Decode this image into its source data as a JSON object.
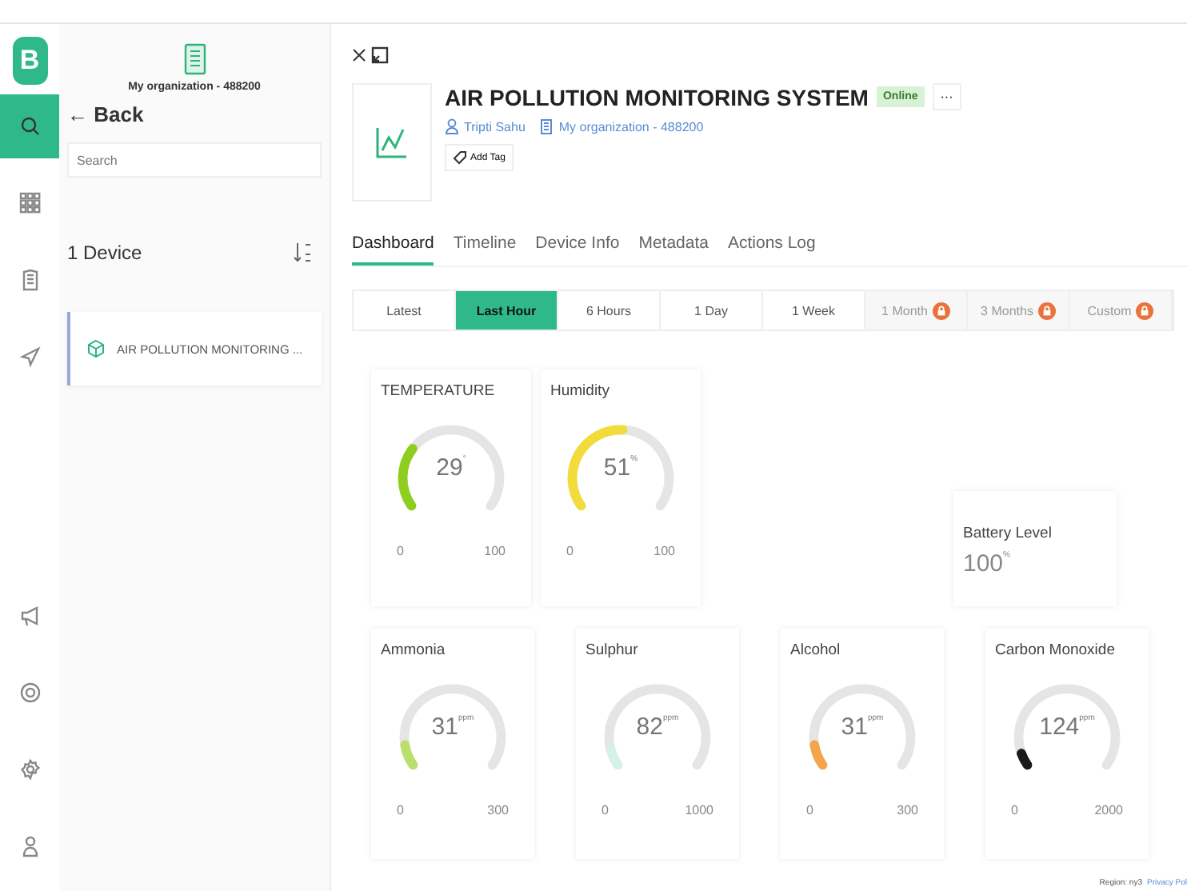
{
  "rail": {
    "logo": "B",
    "top_items": [
      {
        "kind": "search",
        "selected": true
      },
      {
        "kind": "grid",
        "selected": false
      },
      {
        "kind": "building",
        "selected": false
      },
      {
        "kind": "send",
        "selected": false
      }
    ],
    "bottom_items": [
      {
        "kind": "megaphone"
      },
      {
        "kind": "lifebuoy"
      },
      {
        "kind": "gear"
      },
      {
        "kind": "person"
      }
    ]
  },
  "sidebar": {
    "organization": "My organization - 488200",
    "back": "← Back",
    "search": {
      "placeholder": "Search"
    },
    "device_count": "1 Device",
    "devices": [
      {
        "name": "AIR POLLUTION MONITORING ...",
        "selected": true
      }
    ]
  },
  "device": {
    "title": "AIR POLLUTION MONITORING SYSTEM",
    "status": "Online",
    "owner": "Tripti Sahu",
    "organization": "My organization - 488200",
    "add_tag": "Add Tag",
    "more": "···"
  },
  "tabs": [
    {
      "label": "Dashboard",
      "selected": true
    },
    {
      "label": "Timeline",
      "selected": false
    },
    {
      "label": "Device Info",
      "selected": false
    },
    {
      "label": "Metadata",
      "selected": false
    },
    {
      "label": "Actions Log",
      "selected": false
    }
  ],
  "time_ranges": [
    {
      "label": "Latest",
      "selected": false,
      "locked": false
    },
    {
      "label": "Last Hour",
      "selected": true,
      "locked": false
    },
    {
      "label": "6 Hours",
      "selected": false,
      "locked": false
    },
    {
      "label": "1 Day",
      "selected": false,
      "locked": false
    },
    {
      "label": "1 Week",
      "selected": false,
      "locked": false
    },
    {
      "label": "1 Month",
      "selected": false,
      "locked": true
    },
    {
      "label": "3 Months",
      "selected": false,
      "locked": true
    },
    {
      "label": "Custom",
      "selected": false,
      "locked": true
    }
  ],
  "widget_rows": [
    [
      {
        "kind": "gauge",
        "title": "TEMPERATURE",
        "value": "29",
        "unit": "°",
        "min": "0",
        "max": "100",
        "color": "#8fce1e"
      },
      {
        "kind": "gauge",
        "title": "Humidity",
        "value": "51",
        "unit": "%",
        "min": "0",
        "max": "100",
        "color": "#f2dc3c"
      },
      {
        "kind": "value",
        "title": "Battery Level",
        "value": "100",
        "unit": "%"
      }
    ],
    [
      {
        "kind": "gauge",
        "title": "Ammonia",
        "value": "31",
        "unit": "ppm",
        "min": "0",
        "max": "300",
        "color": "#b8e06a"
      },
      {
        "kind": "gauge",
        "title": "Sulphur",
        "value": "82",
        "unit": "ppm",
        "min": "0",
        "max": "1000",
        "color": "#d4f2e8"
      },
      {
        "kind": "gauge",
        "title": "Alcohol",
        "value": "31",
        "unit": "ppm",
        "min": "0",
        "max": "300",
        "color": "#f4a54a"
      },
      {
        "kind": "gauge",
        "title": "Carbon Monoxide",
        "value": "124",
        "unit": "ppm",
        "min": "0",
        "max": "2000",
        "color": "#1a1a1a"
      }
    ]
  ],
  "footer": {
    "region": "Region: ny3",
    "privacy": "Privacy Pol"
  }
}
